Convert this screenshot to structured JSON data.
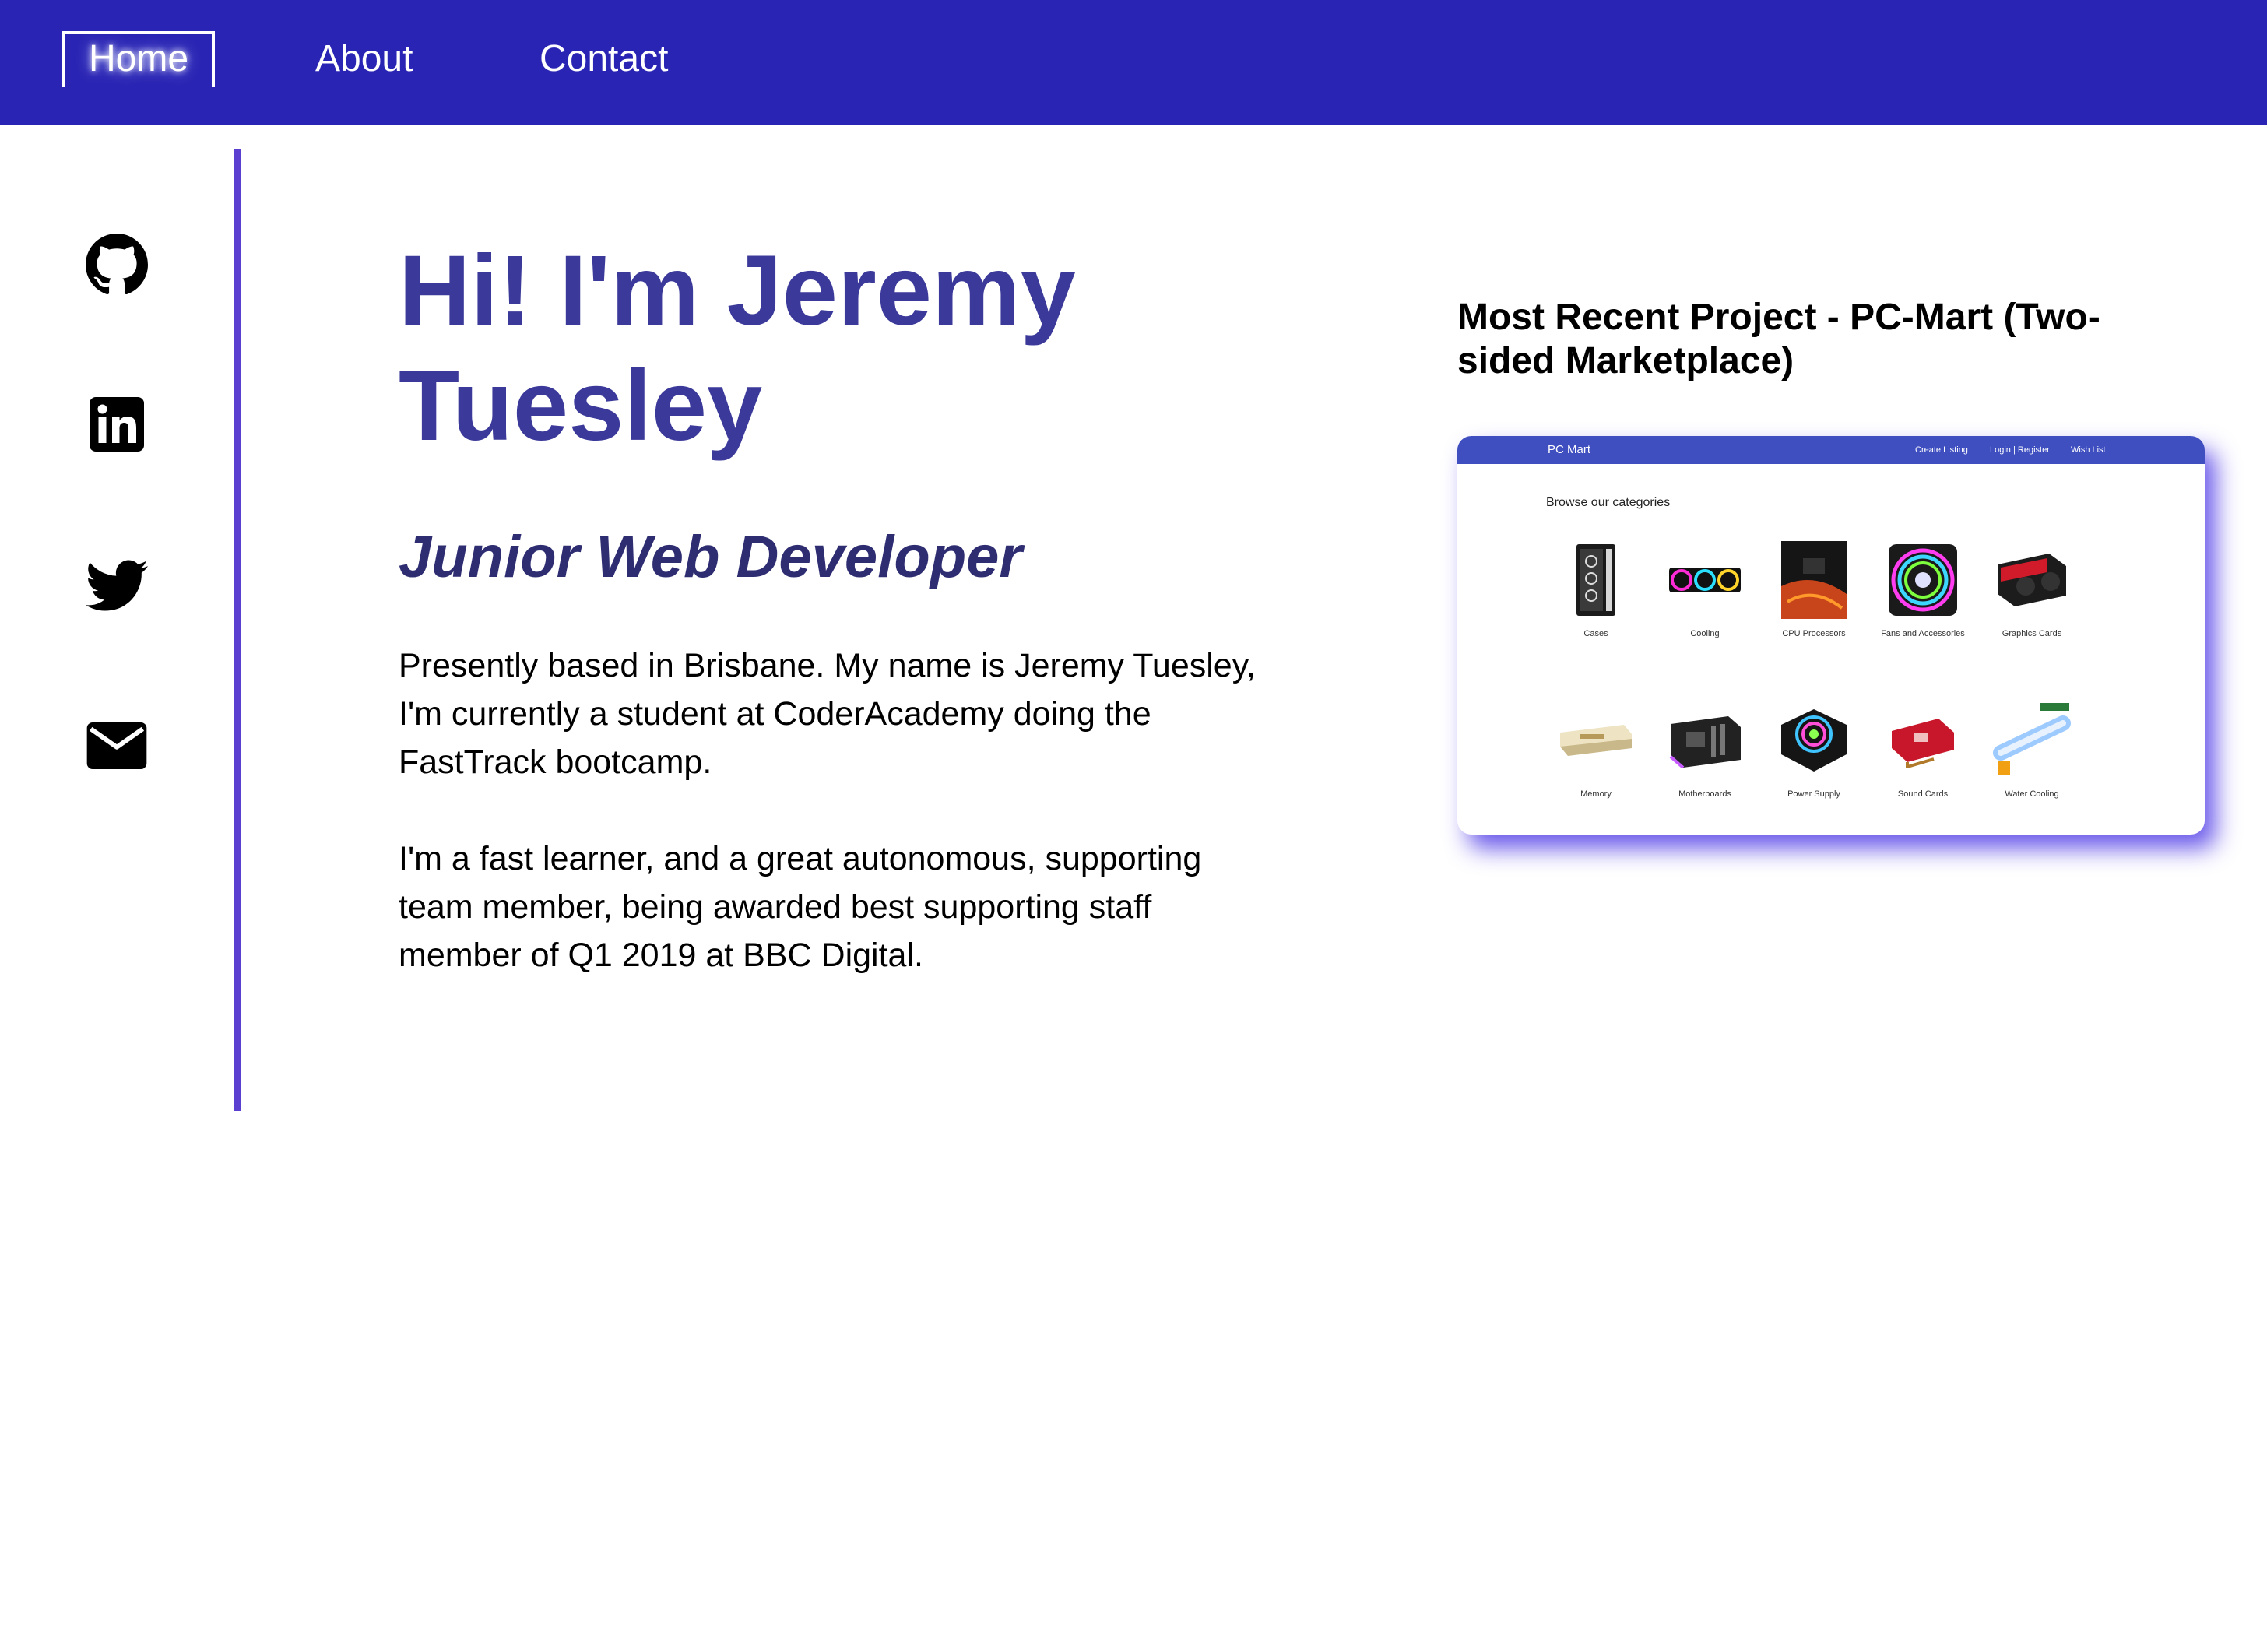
{
  "nav": {
    "items": [
      {
        "label": "Home",
        "active": true
      },
      {
        "label": "About",
        "active": false
      },
      {
        "label": "Contact",
        "active": false
      }
    ]
  },
  "social": {
    "icons": [
      "github-icon",
      "linkedin-icon",
      "twitter-icon",
      "email-icon"
    ]
  },
  "hero": {
    "title": "Hi! I'm Jeremy Tuesley",
    "subtitle": "Junior Web Developer",
    "paragraphs": [
      "Presently based in Brisbane. My name is Jeremy Tuesley, I'm currently a student at CoderAcademy doing the FastTrack bootcamp.",
      "I'm a fast learner, and a great autonomous, supporting team member, being awarded best supporting staff member of Q1 2019 at BBC Digital."
    ]
  },
  "project": {
    "heading": "Most Recent Project - PC-Mart (Two-sided Marketplace)",
    "screenshot": {
      "brand": "PC Mart",
      "links": [
        "Create Listing",
        "Login | Register",
        "Wish List"
      ],
      "browse": "Browse our categories",
      "categories": [
        "Cases",
        "Cooling",
        "CPU Processors",
        "Fans and Accessories",
        "Graphics Cards",
        "Memory",
        "Motherboards",
        "Power Supply",
        "Sound Cards",
        "Water Cooling"
      ]
    }
  },
  "colors": {
    "nav_bg": "#2a24b4",
    "accent_line": "#5a3fd0",
    "title": "#3b3a9a",
    "subtitle": "#2e2d72"
  }
}
